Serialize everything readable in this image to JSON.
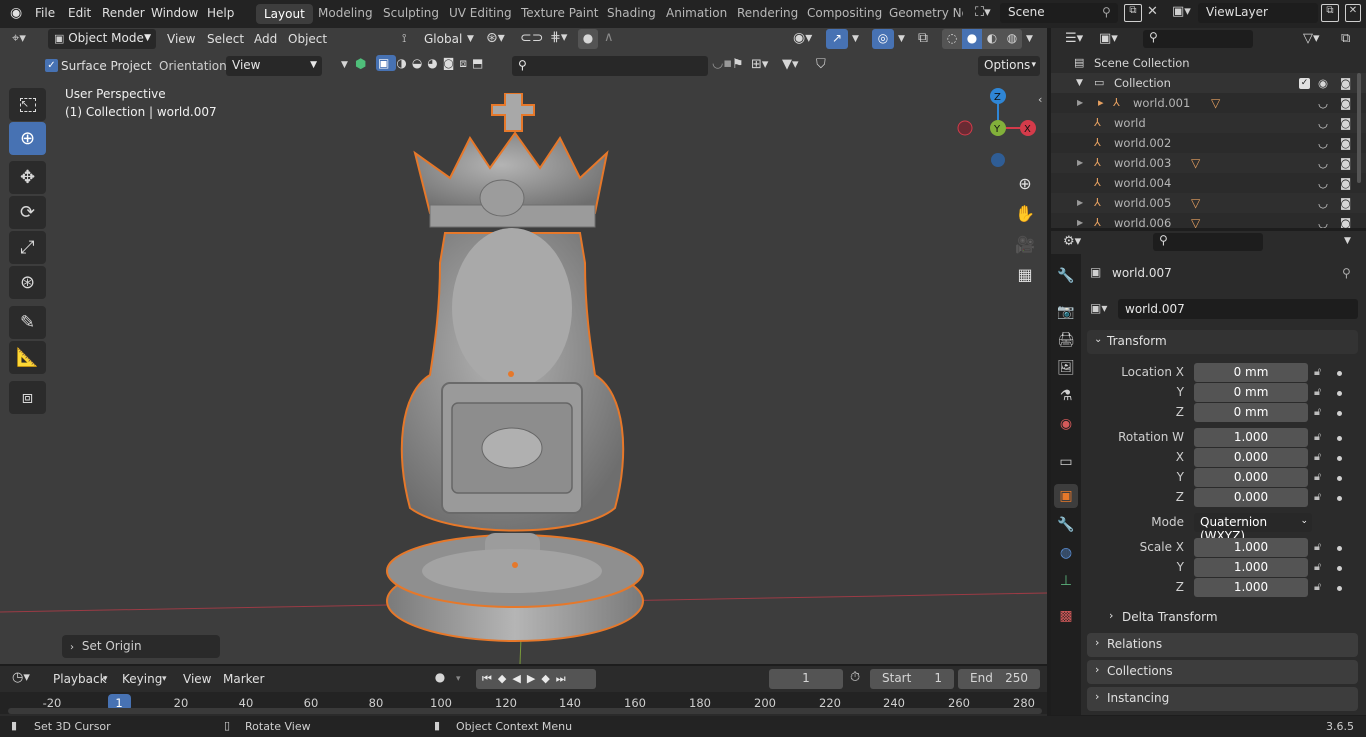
{
  "menu": {
    "file": "File",
    "edit": "Edit",
    "render": "Render",
    "window": "Window",
    "help": "Help"
  },
  "workspaces": [
    "Layout",
    "Modeling",
    "Sculpting",
    "UV Editing",
    "Texture Paint",
    "Shading",
    "Animation",
    "Rendering",
    "Compositing",
    "Geometry Noc"
  ],
  "scene": {
    "name": "Scene",
    "view_layer": "ViewLayer"
  },
  "viewport_header": {
    "mode": "Object Mode",
    "view": "View",
    "select": "Select",
    "add": "Add",
    "object": "Object",
    "orientation_global": "Global"
  },
  "tool_settings": {
    "surface_project": "Surface Project",
    "orientation_label": "Orientation:",
    "orientation_value": "View",
    "options": "Options"
  },
  "viewport_info": {
    "perspective": "User Perspective",
    "collection": "(1) Collection | world.007"
  },
  "gizmo": {
    "z": "Z",
    "y": "Y",
    "x": "X"
  },
  "operator_panel": {
    "label": "Set Origin"
  },
  "outliner": {
    "scene_collection": "Scene Collection",
    "collection": "Collection",
    "items": [
      "world.001",
      "world",
      "world.002",
      "world.003",
      "world.004",
      "world.005",
      "world.006"
    ]
  },
  "properties": {
    "object_name": "world.007",
    "data_name": "world.007",
    "transform": {
      "title": "Transform",
      "location_label": "Location X",
      "loc_x": "0 mm",
      "loc_y": "0 mm",
      "loc_z": "0 mm",
      "rotation_label": "Rotation W",
      "rot_w": "1.000",
      "rot_x": "0.000",
      "rot_y": "0.000",
      "rot_z": "0.000",
      "mode_label": "Mode",
      "mode_value": "Quaternion (WXYZ)",
      "scale_label": "Scale X",
      "scale_x": "1.000",
      "scale_y": "1.000",
      "scale_z": "1.000",
      "y": "Y",
      "z": "Z",
      "x": "X",
      "delta": "Delta Transform"
    },
    "panels": [
      "Relations",
      "Collections",
      "Instancing"
    ]
  },
  "timeline": {
    "playback": "Playback",
    "keying": "Keying",
    "view": "View",
    "marker": "Marker",
    "current_frame": "1",
    "start_label": "Start",
    "start": "1",
    "end_label": "End",
    "end": "250",
    "ticks": [
      "-20",
      "1",
      "20",
      "40",
      "60",
      "80",
      "100",
      "120",
      "140",
      "160",
      "180",
      "200",
      "220",
      "240",
      "260",
      "280"
    ]
  },
  "status": {
    "left": "Set 3D Cursor",
    "middle": "Rotate View",
    "right": "Object Context Menu",
    "version": "3.6.5"
  },
  "colors": {
    "accent": "#4772b3",
    "selection": "#e6782a",
    "axis_x": "#d43b4a",
    "axis_y": "#82b03a",
    "axis_z": "#2f86d6"
  }
}
